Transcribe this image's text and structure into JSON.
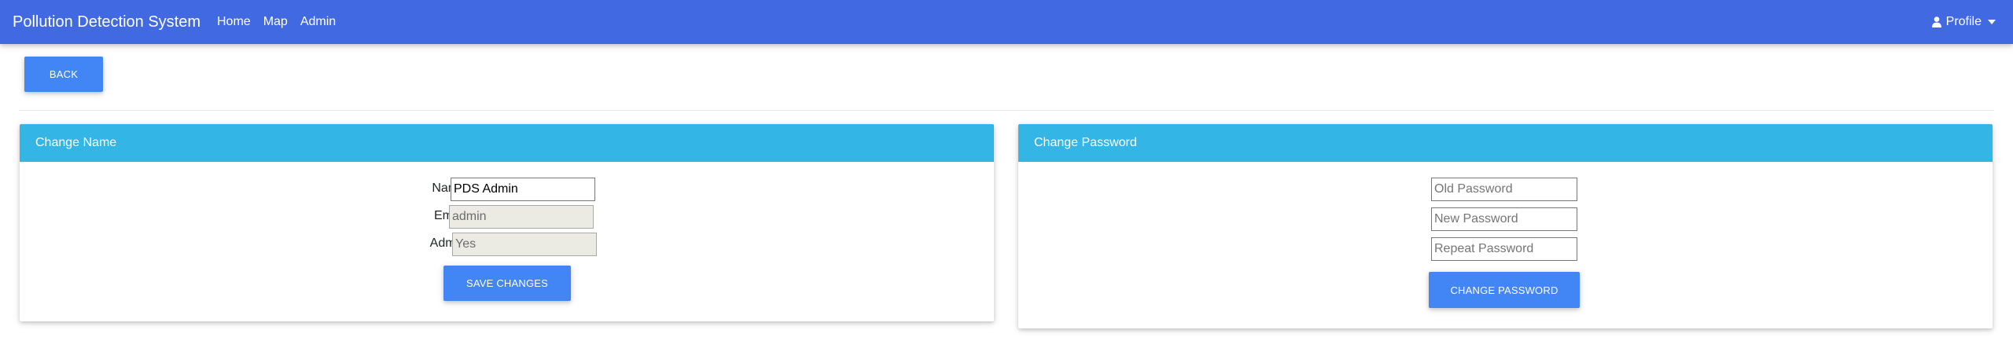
{
  "navbar": {
    "brand": "Pollution Detection System",
    "links": [
      "Home",
      "Map",
      "Admin"
    ],
    "profile_label": "Profile"
  },
  "back_label": "BACK",
  "name_card": {
    "title": "Change Name",
    "name_label": "Name",
    "name_value": "PDS Admin",
    "email_label": "Email",
    "email_value": "admin",
    "admin_label": "Admin",
    "admin_value": "Yes",
    "save_label": "SAVE CHANGES"
  },
  "password_card": {
    "title": "Change Password",
    "old_placeholder": "Old Password",
    "new_placeholder": "New Password",
    "repeat_placeholder": "Repeat Password",
    "change_label": "CHANGE PASSWORD"
  },
  "colors": {
    "navbar": "#4169e1",
    "button": "#4285f4",
    "card_header": "#33b5e5"
  },
  "icons": {
    "profile": "user-icon",
    "profile_dropdown": "caret-down-icon"
  }
}
